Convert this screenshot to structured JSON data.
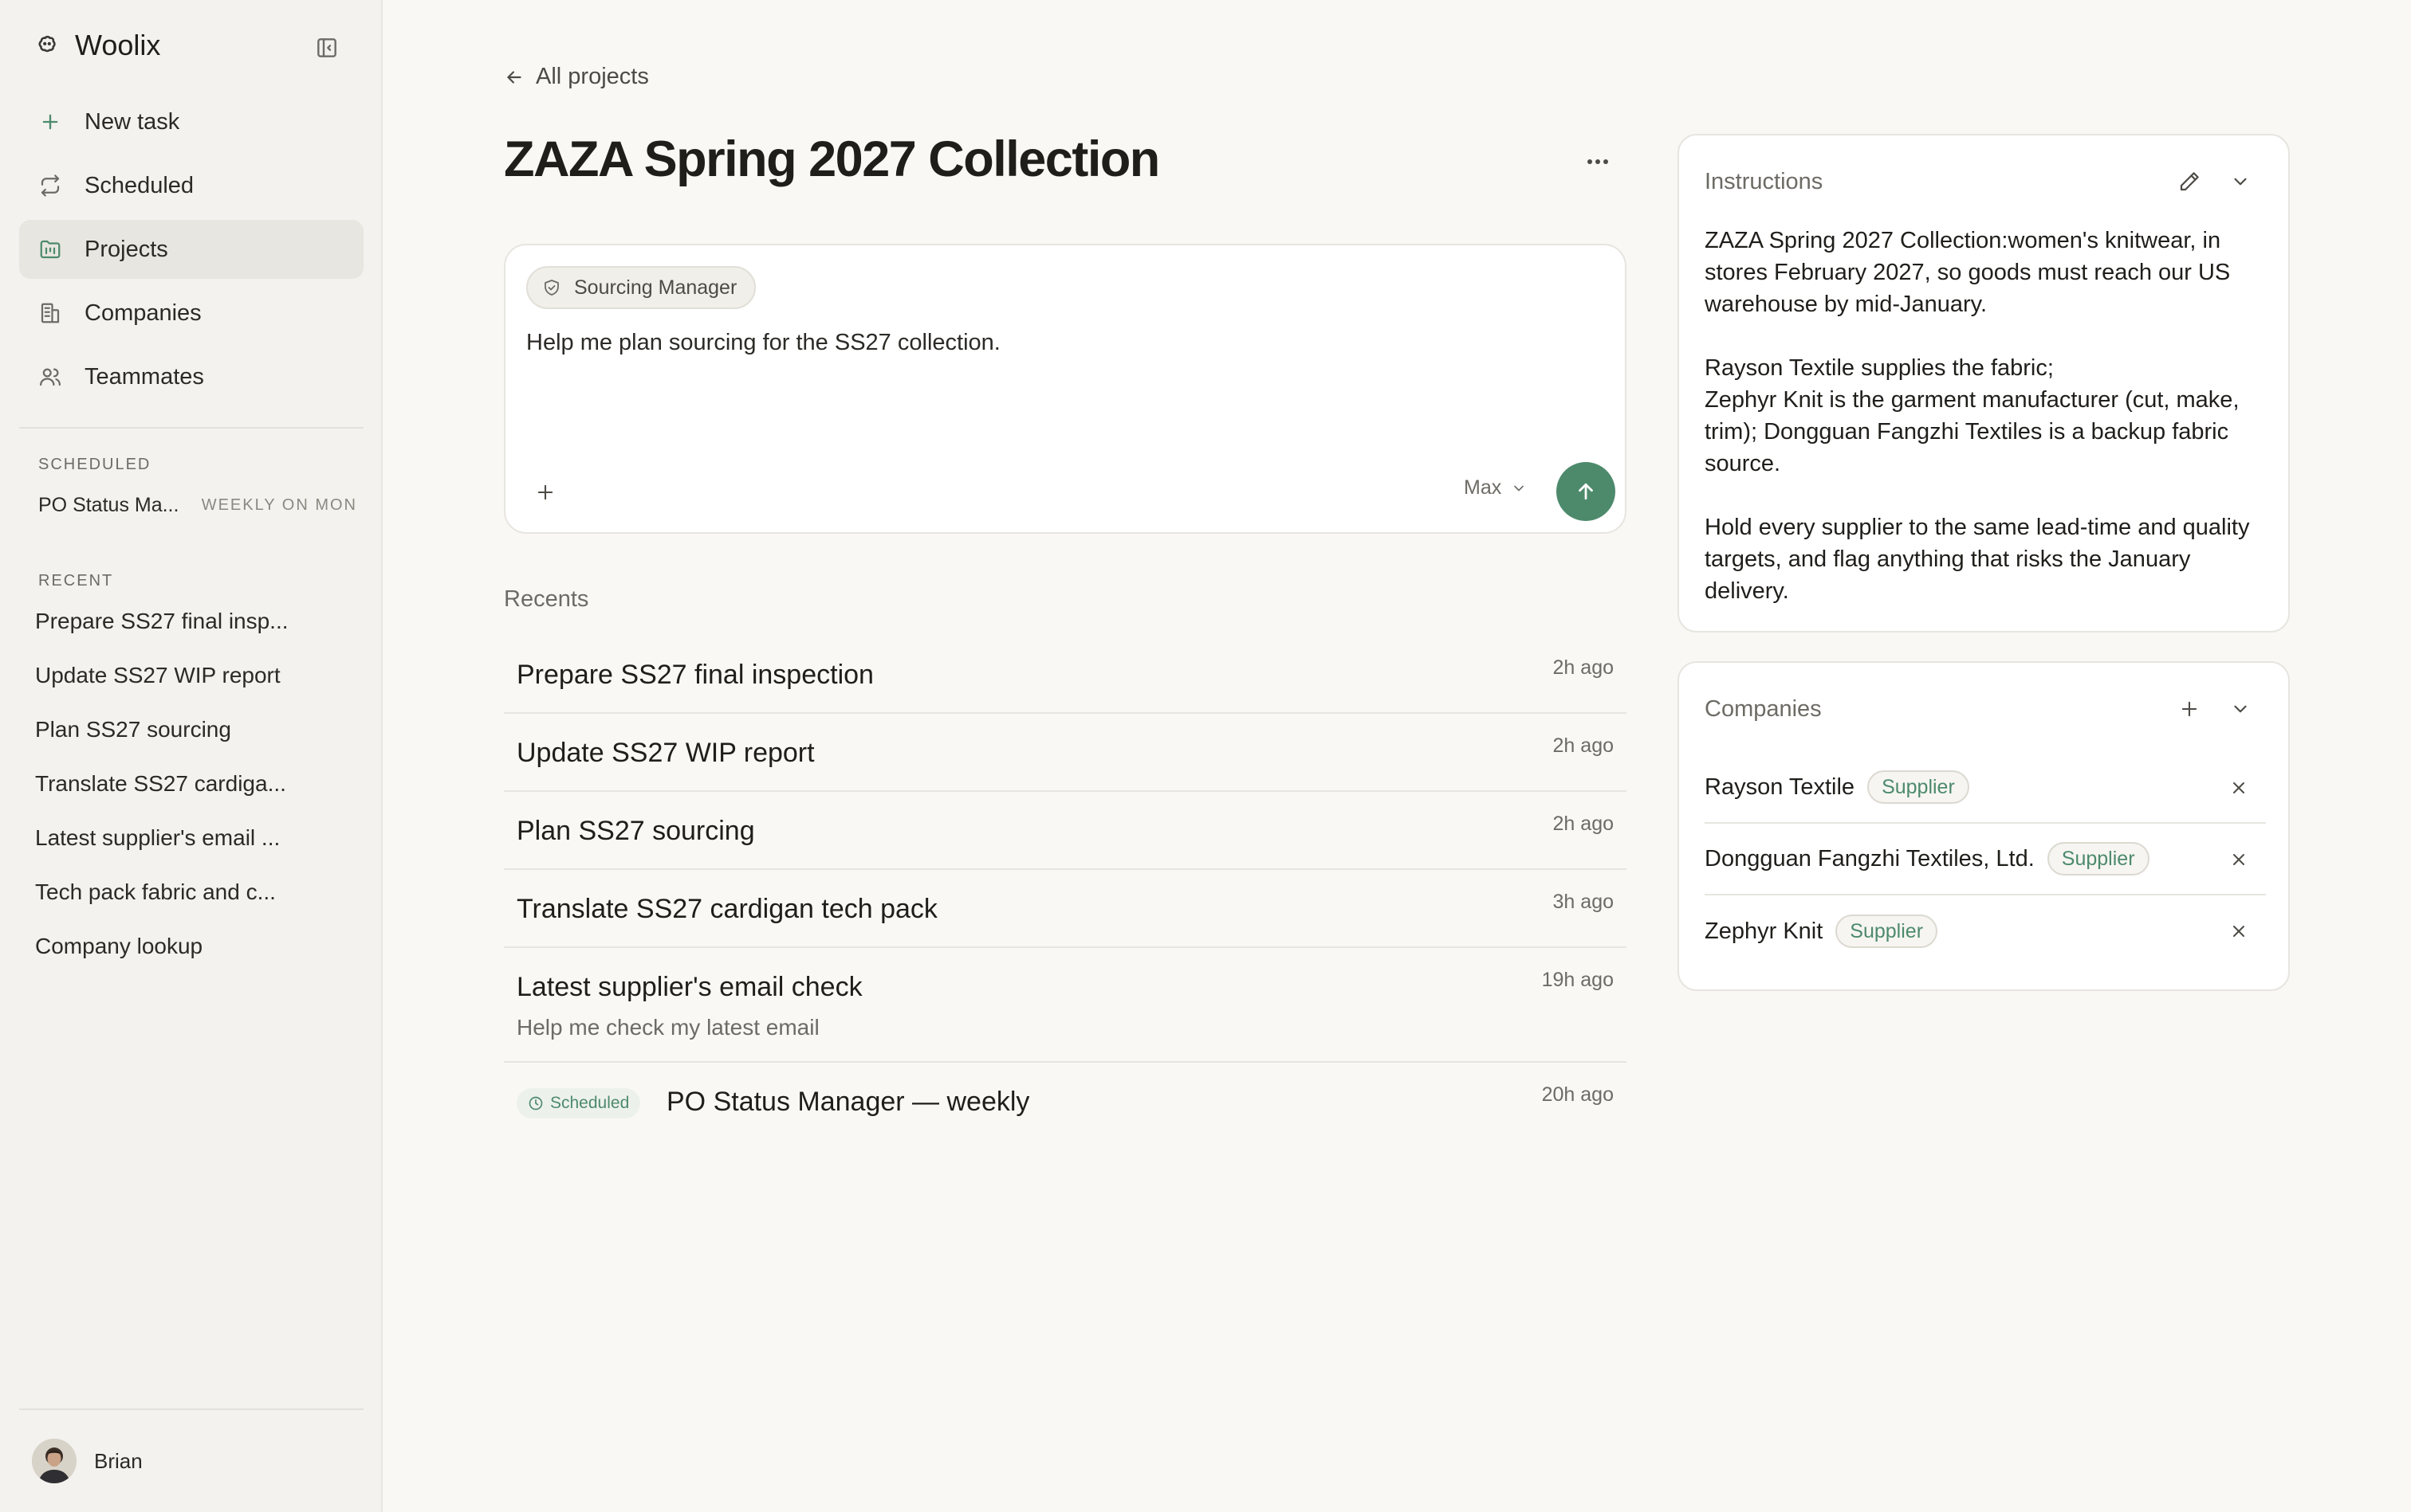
{
  "app": {
    "name": "Woolix"
  },
  "sidebar": {
    "nav": [
      {
        "label": "New task",
        "icon": "plus-icon"
      },
      {
        "label": "Scheduled",
        "icon": "repeat-icon"
      },
      {
        "label": "Projects",
        "icon": "folder-icon",
        "active": true
      },
      {
        "label": "Companies",
        "icon": "building-icon"
      },
      {
        "label": "Teammates",
        "icon": "people-icon"
      }
    ],
    "scheduled_label": "SCHEDULED",
    "scheduled_item": {
      "name": "PO Status Ma...",
      "frequency": "WEEKLY ON MON"
    },
    "recent_label": "RECENT",
    "recent": [
      "Prepare SS27 final insp...",
      "Update SS27 WIP report",
      "Plan SS27 sourcing",
      "Translate SS27 cardiga...",
      "Latest supplier's email ...",
      "Tech pack fabric and c...",
      "Company lookup"
    ],
    "user": {
      "name": "Brian"
    }
  },
  "main": {
    "back_label": "All projects",
    "title": "ZAZA Spring 2027 Collection",
    "composer": {
      "agent": "Sourcing Manager",
      "prompt": "Help me plan sourcing for the SS27 collection.",
      "model": "Max"
    },
    "recents_heading": "Recents",
    "recents": [
      {
        "title": "Prepare SS27 final inspection",
        "time": "2h ago"
      },
      {
        "title": "Update SS27 WIP report",
        "time": "2h ago"
      },
      {
        "title": "Plan SS27 sourcing",
        "time": "2h ago"
      },
      {
        "title": "Translate SS27 cardigan tech pack",
        "time": "3h ago"
      },
      {
        "title": "Latest supplier's email check",
        "subtitle": "Help me check my latest email",
        "time": "19h ago"
      },
      {
        "badge": "Scheduled",
        "title": "PO Status Manager — weekly",
        "time": "20h ago"
      }
    ]
  },
  "instructions": {
    "heading": "Instructions",
    "paragraphs": [
      "ZAZA Spring 2027 Collection:women's knitwear, in stores February 2027, so goods must reach our US warehouse by mid-January.",
      "Rayson Textile supplies the fabric;",
      "Zephyr Knit is the garment manufacturer (cut, make, trim); Dongguan Fangzhi Textiles is a backup fabric source.",
      "Hold every supplier to the same lead-time and quality targets, and flag anything that risks the January delivery."
    ]
  },
  "companies": {
    "heading": "Companies",
    "items": [
      {
        "name": "Rayson Textile",
        "role": "Supplier"
      },
      {
        "name": "Dongguan Fangzhi Textiles, Ltd.",
        "role": "Supplier"
      },
      {
        "name": "Zephyr Knit",
        "role": "Supplier"
      }
    ]
  },
  "colors": {
    "accent": "#4d8a6c",
    "background": "#f9f8f5",
    "sidebar": "#f3f2ee"
  }
}
